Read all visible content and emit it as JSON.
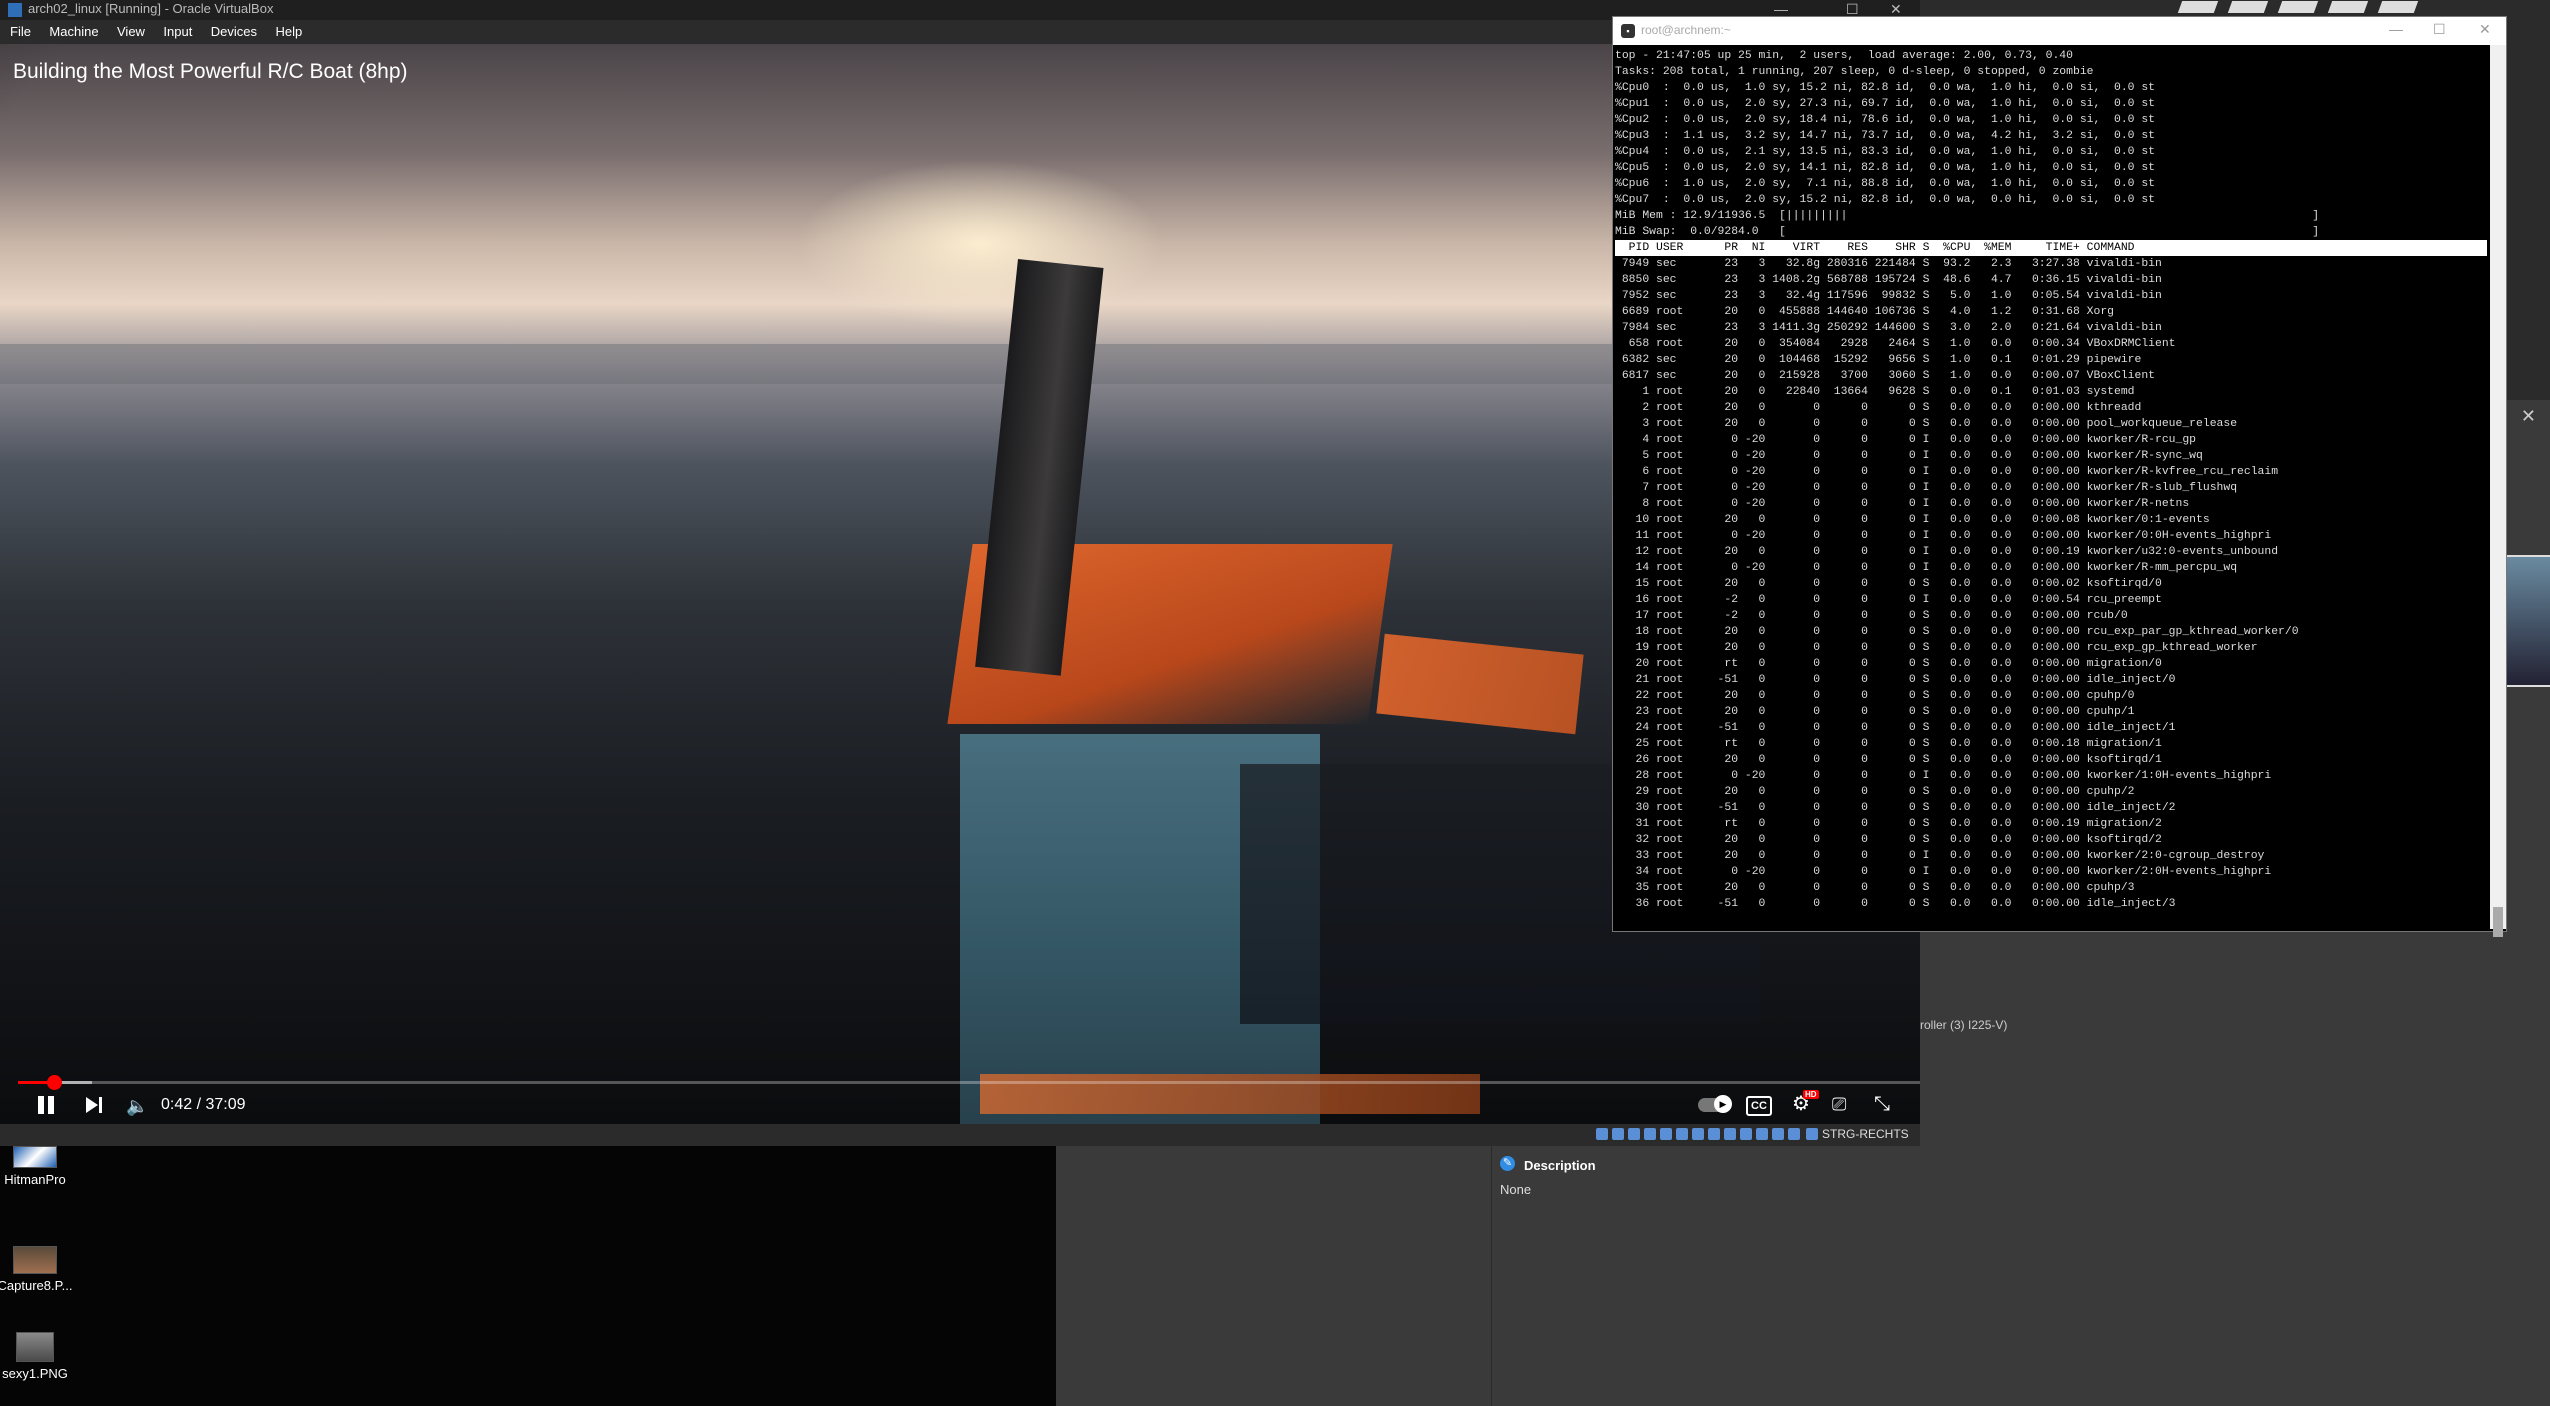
{
  "vbox": {
    "title": "arch02_linux [Running] - Oracle VirtualBox",
    "menu": [
      "File",
      "Machine",
      "View",
      "Input",
      "Devices",
      "Help"
    ],
    "host_key": "STRG-RECHTS"
  },
  "video": {
    "title": "Building the Most Powerful R/C Boat (8hp)",
    "current_time": "0:42",
    "duration": "37:09",
    "time_separator": " / ",
    "progress_fraction": 0.019,
    "hd_badge": "HD",
    "cc_label": "CC",
    "controls": [
      "pause-icon",
      "next-icon",
      "volume-icon",
      "autoplay-toggle",
      "cc-icon",
      "settings-icon",
      "cast-icon",
      "fullscreen-exit-icon"
    ]
  },
  "terminal": {
    "title": "root@archnem:~",
    "summary": [
      "top - 21:47:05 up 25 min,  2 users,  load average: 2.00, 0.73, 0.40",
      "Tasks: 208 total, 1 running, 207 sleep, 0 d-sleep, 0 stopped, 0 zombie",
      "%Cpu0  :  0.0 us,  1.0 sy, 15.2 ni, 82.8 id,  0.0 wa,  1.0 hi,  0.0 si,  0.0 st",
      "%Cpu1  :  0.0 us,  2.0 sy, 27.3 ni, 69.7 id,  0.0 wa,  1.0 hi,  0.0 si,  0.0 st",
      "%Cpu2  :  0.0 us,  2.0 sy, 18.4 ni, 78.6 id,  0.0 wa,  1.0 hi,  0.0 si,  0.0 st",
      "%Cpu3  :  1.1 us,  3.2 sy, 14.7 ni, 73.7 id,  0.0 wa,  4.2 hi,  3.2 si,  0.0 st",
      "%Cpu4  :  0.0 us,  2.1 sy, 13.5 ni, 83.3 id,  0.0 wa,  1.0 hi,  0.0 si,  0.0 st",
      "%Cpu5  :  0.0 us,  2.0 sy, 14.1 ni, 82.8 id,  0.0 wa,  1.0 hi,  0.0 si,  0.0 st",
      "%Cpu6  :  1.0 us,  2.0 sy,  7.1 ni, 88.8 id,  0.0 wa,  1.0 hi,  0.0 si,  0.0 st",
      "%Cpu7  :  0.0 us,  2.0 sy, 15.2 ni, 82.8 id,  0.0 wa,  0.0 hi,  0.0 si,  0.0 st",
      "MiB Mem : 12.9/11936.5  [|||||||||                                                                    ]",
      "MiB Swap:  0.0/9284.0   [                                                                             ]",
      ""
    ],
    "header": "  PID USER      PR  NI    VIRT    RES    SHR S  %CPU  %MEM     TIME+ COMMAND",
    "processes": [
      " 7949 sec       23   3   32.8g 280316 221484 S  93.2   2.3   3:27.38 vivaldi-bin",
      " 8850 sec       23   3 1408.2g 568788 195724 S  48.6   4.7   0:36.15 vivaldi-bin",
      " 7952 sec       23   3   32.4g 117596  99832 S   5.0   1.0   0:05.54 vivaldi-bin",
      " 6689 root      20   0  455888 144640 106736 S   4.0   1.2   0:31.68 Xorg",
      " 7984 sec       23   3 1411.3g 250292 144600 S   3.0   2.0   0:21.64 vivaldi-bin",
      "  658 root      20   0  354084   2928   2464 S   1.0   0.0   0:00.34 VBoxDRMClient",
      " 6382 sec       20   0  104468  15292   9656 S   1.0   0.1   0:01.29 pipewire",
      " 6817 sec       20   0  215928   3700   3060 S   1.0   0.0   0:00.07 VBoxClient",
      "    1 root      20   0   22840  13664   9628 S   0.0   0.1   0:01.03 systemd",
      "    2 root      20   0       0      0      0 S   0.0   0.0   0:00.00 kthreadd",
      "    3 root      20   0       0      0      0 S   0.0   0.0   0:00.00 pool_workqueue_release",
      "    4 root       0 -20       0      0      0 I   0.0   0.0   0:00.00 kworker/R-rcu_gp",
      "    5 root       0 -20       0      0      0 I   0.0   0.0   0:00.00 kworker/R-sync_wq",
      "    6 root       0 -20       0      0      0 I   0.0   0.0   0:00.00 kworker/R-kvfree_rcu_reclaim",
      "    7 root       0 -20       0      0      0 I   0.0   0.0   0:00.00 kworker/R-slub_flushwq",
      "    8 root       0 -20       0      0      0 I   0.0   0.0   0:00.00 kworker/R-netns",
      "   10 root      20   0       0      0      0 I   0.0   0.0   0:00.08 kworker/0:1-events",
      "   11 root       0 -20       0      0      0 I   0.0   0.0   0:00.00 kworker/0:0H-events_highpri",
      "   12 root      20   0       0      0      0 I   0.0   0.0   0:00.19 kworker/u32:0-events_unbound",
      "   14 root       0 -20       0      0      0 I   0.0   0.0   0:00.00 kworker/R-mm_percpu_wq",
      "   15 root      20   0       0      0      0 S   0.0   0.0   0:00.02 ksoftirqd/0",
      "   16 root      -2   0       0      0      0 I   0.0   0.0   0:00.54 rcu_preempt",
      "   17 root      -2   0       0      0      0 S   0.0   0.0   0:00.00 rcub/0",
      "   18 root      20   0       0      0      0 S   0.0   0.0   0:00.00 rcu_exp_par_gp_kthread_worker/0",
      "   19 root      20   0       0      0      0 S   0.0   0.0   0:00.00 rcu_exp_gp_kthread_worker",
      "   20 root      rt   0       0      0      0 S   0.0   0.0   0:00.00 migration/0",
      "   21 root     -51   0       0      0      0 S   0.0   0.0   0:00.00 idle_inject/0",
      "   22 root      20   0       0      0      0 S   0.0   0.0   0:00.00 cpuhp/0",
      "   23 root      20   0       0      0      0 S   0.0   0.0   0:00.00 cpuhp/1",
      "   24 root     -51   0       0      0      0 S   0.0   0.0   0:00.00 idle_inject/1",
      "   25 root      rt   0       0      0      0 S   0.0   0.0   0:00.18 migration/1",
      "   26 root      20   0       0      0      0 S   0.0   0.0   0:00.00 ksoftirqd/1",
      "   28 root       0 -20       0      0      0 I   0.0   0.0   0:00.00 kworker/1:0H-events_highpri",
      "   29 root      20   0       0      0      0 S   0.0   0.0   0:00.00 cpuhp/2",
      "   30 root     -51   0       0      0      0 S   0.0   0.0   0:00.00 idle_inject/2",
      "   31 root      rt   0       0      0      0 S   0.0   0.0   0:00.19 migration/2",
      "   32 root      20   0       0      0      0 S   0.0   0.0   0:00.00 ksoftirqd/2",
      "   33 root      20   0       0      0      0 I   0.0   0.0   0:00.00 kworker/2:0-cgroup_destroy",
      "   34 root       0 -20       0      0      0 I   0.0   0.0   0:00.00 kworker/2:0H-events_highpri",
      "   35 root      20   0       0      0      0 S   0.0   0.0   0:00.00 cpuhp/3",
      "   36 root     -51   0       0      0      0 S   0.0   0.0   0:00.00 idle_inject/3"
    ]
  },
  "host": {
    "desktop_icons": [
      "HitmanPro",
      "Capture8.P...",
      "sexy1.PNG"
    ],
    "controller_text": "roller (3) I225-V)",
    "description_title": "Description",
    "description_value": "None"
  }
}
